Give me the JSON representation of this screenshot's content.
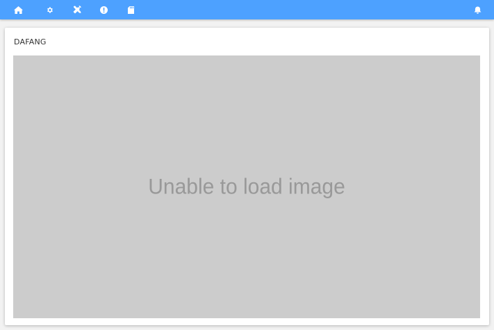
{
  "navbar": {
    "accent_color": "#4da1ff",
    "left_items": [
      {
        "icon": "home-icon"
      },
      {
        "icon": "gear-icon"
      },
      {
        "icon": "tools-icon"
      },
      {
        "icon": "info-icon"
      },
      {
        "icon": "sd-card-icon"
      }
    ],
    "right_items": [
      {
        "icon": "bell-icon"
      }
    ]
  },
  "card": {
    "title": "DAFANG",
    "image_placeholder": "Unable to load image",
    "placeholder_color": "#cccccc"
  }
}
